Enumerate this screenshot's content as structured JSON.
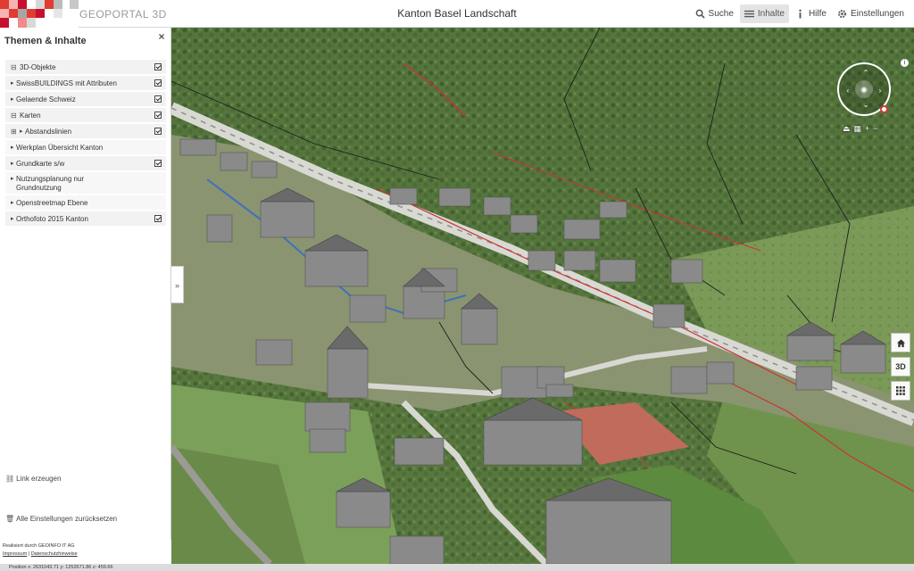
{
  "header": {
    "brand": "GEOPORTAL 3D",
    "title": "Kanton Basel Landschaft",
    "nav": [
      {
        "label": "Suche",
        "icon": "search-icon"
      },
      {
        "label": "Inhalte",
        "icon": "menu-icon",
        "active": true
      },
      {
        "label": "Hilfe",
        "icon": "info-icon"
      },
      {
        "label": "Einstellungen",
        "icon": "gear-icon"
      }
    ]
  },
  "sidebar": {
    "title": "Themen & Inhalte",
    "close": "×",
    "layers": [
      {
        "label": "3D-Objekte",
        "expander": "⊟",
        "checked": true
      },
      {
        "label": "SwissBUILDINGS mit Attributen",
        "arrow": "▸",
        "checked": true
      },
      {
        "label": "Gelaende Schweiz",
        "arrow": "▸",
        "checked": true
      },
      {
        "label": "Karten",
        "expander": "⊟",
        "checked": true
      },
      {
        "label": "Abstandslinien",
        "expander": "⊞",
        "arrow": "▸",
        "checked": true
      },
      {
        "label": "Werkplan Übersicht Kanton",
        "arrow": "▸",
        "checked": false
      },
      {
        "label": "Grundkarte s/w",
        "arrow": "▸",
        "checked": true
      },
      {
        "label": "Nutzungsplanung nur Grundnutzung",
        "arrow": "▸",
        "checked": false
      },
      {
        "label": "Openstreetmap Ebene",
        "arrow": "▸",
        "checked": false
      },
      {
        "label": "Orthofoto 2015 Kanton",
        "arrow": "▸",
        "checked": true
      }
    ],
    "link_label": "Link erzeugen",
    "reset_label": "Alle Einstellungen zurücksetzen",
    "collapse": "»"
  },
  "footer": {
    "credit": "Realisiert durch GEOINFO IT AG",
    "impressum": "Impressum",
    "separator": "|",
    "privacy": "Datenschutzhinweise"
  },
  "status": {
    "position": "Position x: 2631043.71 y: 1252671.86 z: 459.66"
  },
  "map_controls": {
    "home_icon": "home-icon",
    "mode_label": "3D",
    "grid_icon": "grid-icon",
    "zoom_in": "+",
    "zoom_out": "−"
  },
  "colors": {
    "accent_active": "#e4e4e4",
    "logo_red": "#c8102e",
    "compass_pin": "#d23a3a"
  }
}
